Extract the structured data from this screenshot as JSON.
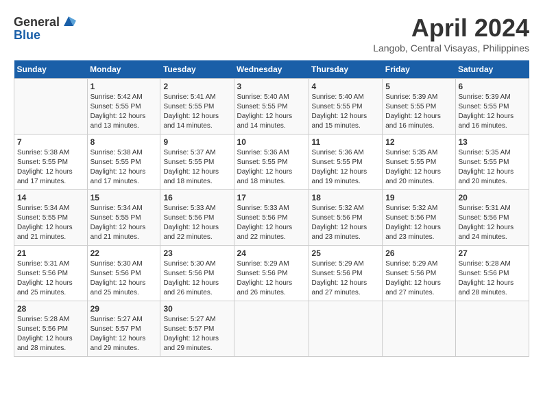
{
  "header": {
    "logo_general": "General",
    "logo_blue": "Blue",
    "month": "April 2024",
    "location": "Langob, Central Visayas, Philippines"
  },
  "days_of_week": [
    "Sunday",
    "Monday",
    "Tuesday",
    "Wednesday",
    "Thursday",
    "Friday",
    "Saturday"
  ],
  "weeks": [
    [
      {
        "day": "",
        "info": ""
      },
      {
        "day": "1",
        "info": "Sunrise: 5:42 AM\nSunset: 5:55 PM\nDaylight: 12 hours\nand 13 minutes."
      },
      {
        "day": "2",
        "info": "Sunrise: 5:41 AM\nSunset: 5:55 PM\nDaylight: 12 hours\nand 14 minutes."
      },
      {
        "day": "3",
        "info": "Sunrise: 5:40 AM\nSunset: 5:55 PM\nDaylight: 12 hours\nand 14 minutes."
      },
      {
        "day": "4",
        "info": "Sunrise: 5:40 AM\nSunset: 5:55 PM\nDaylight: 12 hours\nand 15 minutes."
      },
      {
        "day": "5",
        "info": "Sunrise: 5:39 AM\nSunset: 5:55 PM\nDaylight: 12 hours\nand 16 minutes."
      },
      {
        "day": "6",
        "info": "Sunrise: 5:39 AM\nSunset: 5:55 PM\nDaylight: 12 hours\nand 16 minutes."
      }
    ],
    [
      {
        "day": "7",
        "info": "Sunrise: 5:38 AM\nSunset: 5:55 PM\nDaylight: 12 hours\nand 17 minutes."
      },
      {
        "day": "8",
        "info": "Sunrise: 5:38 AM\nSunset: 5:55 PM\nDaylight: 12 hours\nand 17 minutes."
      },
      {
        "day": "9",
        "info": "Sunrise: 5:37 AM\nSunset: 5:55 PM\nDaylight: 12 hours\nand 18 minutes."
      },
      {
        "day": "10",
        "info": "Sunrise: 5:36 AM\nSunset: 5:55 PM\nDaylight: 12 hours\nand 18 minutes."
      },
      {
        "day": "11",
        "info": "Sunrise: 5:36 AM\nSunset: 5:55 PM\nDaylight: 12 hours\nand 19 minutes."
      },
      {
        "day": "12",
        "info": "Sunrise: 5:35 AM\nSunset: 5:55 PM\nDaylight: 12 hours\nand 20 minutes."
      },
      {
        "day": "13",
        "info": "Sunrise: 5:35 AM\nSunset: 5:55 PM\nDaylight: 12 hours\nand 20 minutes."
      }
    ],
    [
      {
        "day": "14",
        "info": "Sunrise: 5:34 AM\nSunset: 5:55 PM\nDaylight: 12 hours\nand 21 minutes."
      },
      {
        "day": "15",
        "info": "Sunrise: 5:34 AM\nSunset: 5:55 PM\nDaylight: 12 hours\nand 21 minutes."
      },
      {
        "day": "16",
        "info": "Sunrise: 5:33 AM\nSunset: 5:56 PM\nDaylight: 12 hours\nand 22 minutes."
      },
      {
        "day": "17",
        "info": "Sunrise: 5:33 AM\nSunset: 5:56 PM\nDaylight: 12 hours\nand 22 minutes."
      },
      {
        "day": "18",
        "info": "Sunrise: 5:32 AM\nSunset: 5:56 PM\nDaylight: 12 hours\nand 23 minutes."
      },
      {
        "day": "19",
        "info": "Sunrise: 5:32 AM\nSunset: 5:56 PM\nDaylight: 12 hours\nand 23 minutes."
      },
      {
        "day": "20",
        "info": "Sunrise: 5:31 AM\nSunset: 5:56 PM\nDaylight: 12 hours\nand 24 minutes."
      }
    ],
    [
      {
        "day": "21",
        "info": "Sunrise: 5:31 AM\nSunset: 5:56 PM\nDaylight: 12 hours\nand 25 minutes."
      },
      {
        "day": "22",
        "info": "Sunrise: 5:30 AM\nSunset: 5:56 PM\nDaylight: 12 hours\nand 25 minutes."
      },
      {
        "day": "23",
        "info": "Sunrise: 5:30 AM\nSunset: 5:56 PM\nDaylight: 12 hours\nand 26 minutes."
      },
      {
        "day": "24",
        "info": "Sunrise: 5:29 AM\nSunset: 5:56 PM\nDaylight: 12 hours\nand 26 minutes."
      },
      {
        "day": "25",
        "info": "Sunrise: 5:29 AM\nSunset: 5:56 PM\nDaylight: 12 hours\nand 27 minutes."
      },
      {
        "day": "26",
        "info": "Sunrise: 5:29 AM\nSunset: 5:56 PM\nDaylight: 12 hours\nand 27 minutes."
      },
      {
        "day": "27",
        "info": "Sunrise: 5:28 AM\nSunset: 5:56 PM\nDaylight: 12 hours\nand 28 minutes."
      }
    ],
    [
      {
        "day": "28",
        "info": "Sunrise: 5:28 AM\nSunset: 5:56 PM\nDaylight: 12 hours\nand 28 minutes."
      },
      {
        "day": "29",
        "info": "Sunrise: 5:27 AM\nSunset: 5:57 PM\nDaylight: 12 hours\nand 29 minutes."
      },
      {
        "day": "30",
        "info": "Sunrise: 5:27 AM\nSunset: 5:57 PM\nDaylight: 12 hours\nand 29 minutes."
      },
      {
        "day": "",
        "info": ""
      },
      {
        "day": "",
        "info": ""
      },
      {
        "day": "",
        "info": ""
      },
      {
        "day": "",
        "info": ""
      }
    ]
  ]
}
